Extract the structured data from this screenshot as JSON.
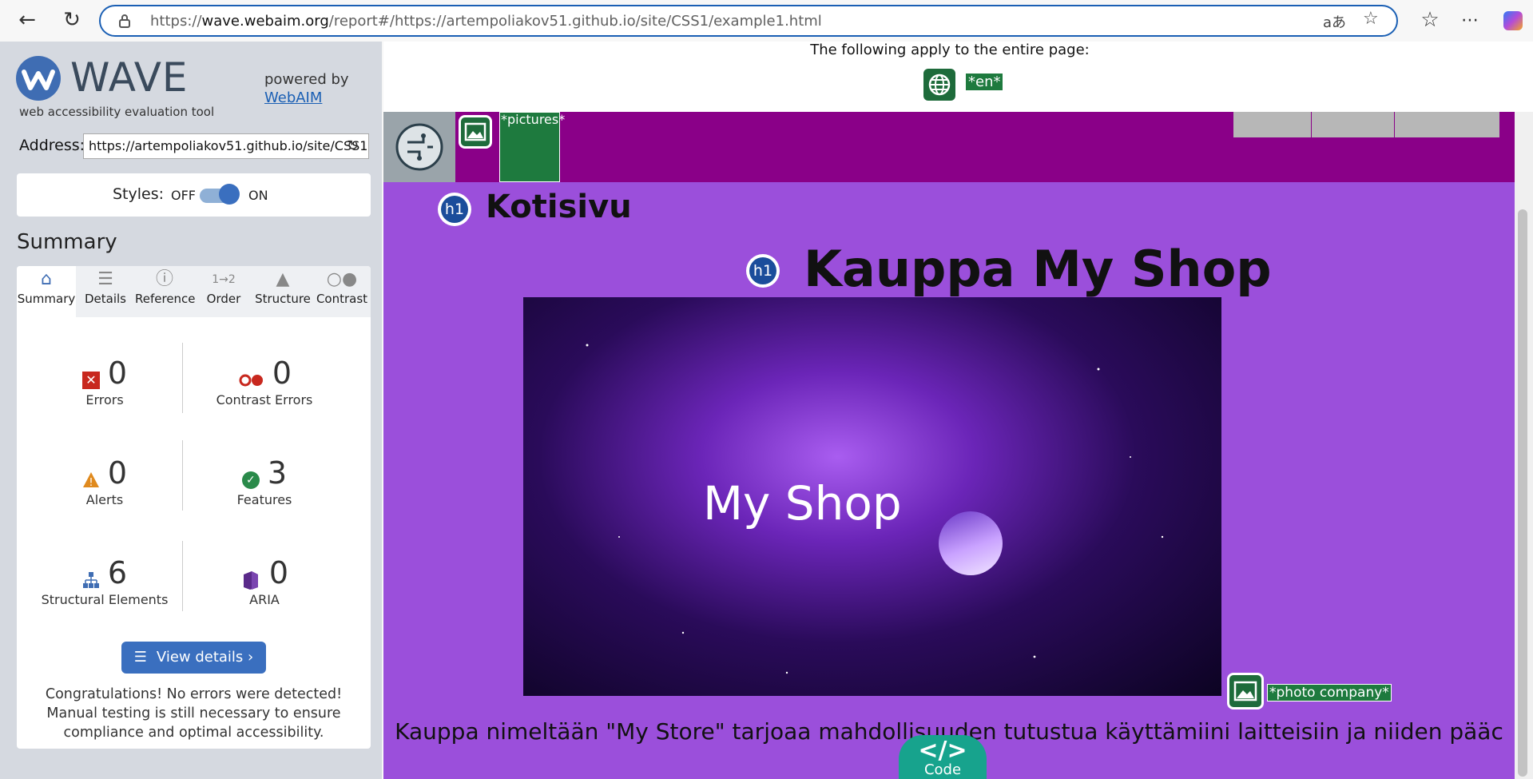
{
  "browser": {
    "url_prefix": "https://",
    "url_host": "wave.webaim.org",
    "url_rest": "/report#/https://artempoliakov51.github.io/site/CSS1/example1.html"
  },
  "wave": {
    "logo_text": "WAVE",
    "subtitle": "web accessibility evaluation tool",
    "powered_by": "powered by",
    "webaim_link": "WebAIM",
    "address_label": "Address:",
    "address_value": "https://artempoliakov51.github.io/site/CSS1",
    "styles_label": "Styles:",
    "styles_off": "OFF",
    "styles_on": "ON",
    "summary_title": "Summary",
    "tabs": [
      {
        "label": "Summary",
        "icon": "home-icon"
      },
      {
        "label": "Details",
        "icon": "list-icon"
      },
      {
        "label": "Reference",
        "icon": "info-icon"
      },
      {
        "label": "Order",
        "icon": "order-icon"
      },
      {
        "label": "Structure",
        "icon": "structure-icon"
      },
      {
        "label": "Contrast",
        "icon": "contrast-icon"
      }
    ],
    "stats": {
      "errors": {
        "value": "0",
        "label": "Errors"
      },
      "contrast_errors": {
        "value": "0",
        "label": "Contrast Errors"
      },
      "alerts": {
        "value": "0",
        "label": "Alerts"
      },
      "features": {
        "value": "3",
        "label": "Features"
      },
      "structural": {
        "value": "6",
        "label": "Structural Elements"
      },
      "aria": {
        "value": "0",
        "label": "ARIA"
      }
    },
    "view_details": "View details ›",
    "congrats": "Congratulations! No errors were detected! Manual testing is still necessary to ensure compliance and optimal accessibility."
  },
  "page": {
    "apply_text": "The following apply to the entire page:",
    "lang_badge": "*en*",
    "pictures_label": "*pictures*",
    "h1_badge": "h1",
    "kotisivu": "Kotisivu",
    "main_title": "Kauppa My Shop",
    "hero_text": "My Shop",
    "photo_label": "*photo company*",
    "paragraph": "Kauppa nimeltään \"My Store\" tarjoaa mahdollisuuden tutustua käyttämiini laitteisiin ja niiden pääc        uksiin.",
    "code_label": "Code",
    "code_symbol": "</>"
  }
}
